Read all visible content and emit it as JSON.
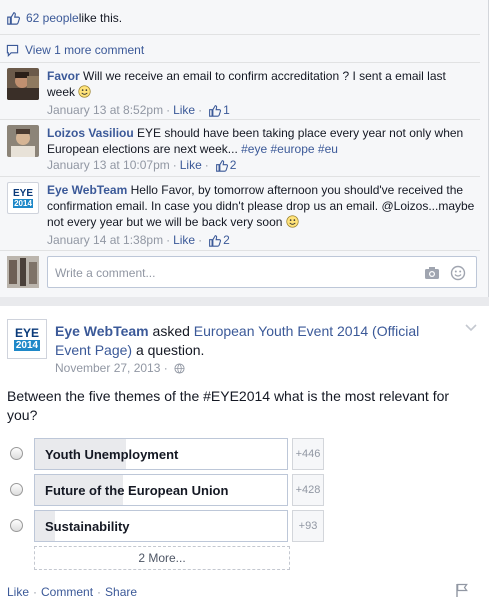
{
  "post1": {
    "likes_text": "62 people",
    "likes_suffix": " like this.",
    "view_more": "View 1 more comment",
    "comments": [
      {
        "author": "Favor",
        "text": " Will we receive an email to confirm accreditation ? I sent a email last week ",
        "time": "January 13 at 8:52pm",
        "like_label": "Like",
        "like_count": "1"
      },
      {
        "author": "Loizos Vasiliou",
        "text_a": " EYE should have been taking place every year not only when European elections are next week... ",
        "hashtags": [
          "#eye",
          "#europe",
          "#eu"
        ],
        "time": "January 13 at 10:07pm",
        "like_label": "Like",
        "like_count": "2"
      },
      {
        "author": "Eye WebTeam",
        "text": " Hello Favor, by tomorrow afternoon you should've received the confirmation email. In case you didn't please drop us an email. @Loizos...maybe not every year but we will be back very soon ",
        "time": "January 14 at 1:38pm",
        "like_label": "Like",
        "like_count": "2"
      }
    ],
    "write_placeholder": "Write a comment..."
  },
  "post2": {
    "logo_line1": "EYE",
    "logo_line2": "2014",
    "page_name": "Eye WebTeam",
    "verb": " asked ",
    "target": "European Youth Event 2014 (Official Event Page)",
    "suffix": " a question.",
    "date": "November 27, 2013 ·",
    "question": "Between the five themes of the #EYE2014 what is the most relevant for you?",
    "options": [
      {
        "label": "Youth Unemployment",
        "count": "+446",
        "share": 0.36
      },
      {
        "label": "Future of the European Union",
        "count": "+428",
        "share": 0.35
      },
      {
        "label": "Sustainability",
        "count": "+93",
        "share": 0.08
      }
    ],
    "more_label": "2 More...",
    "actions": {
      "like": "Like",
      "comment": "Comment",
      "share": "Share"
    }
  },
  "colors": {
    "link": "#3b5998",
    "muted": "#9197a3",
    "accent": "#1e88c8"
  },
  "icons": [
    "thumbs-up-icon",
    "comment-bubble-icon",
    "camera-icon",
    "smiley-icon",
    "globe-icon",
    "chevron-down-icon",
    "flag-icon"
  ]
}
